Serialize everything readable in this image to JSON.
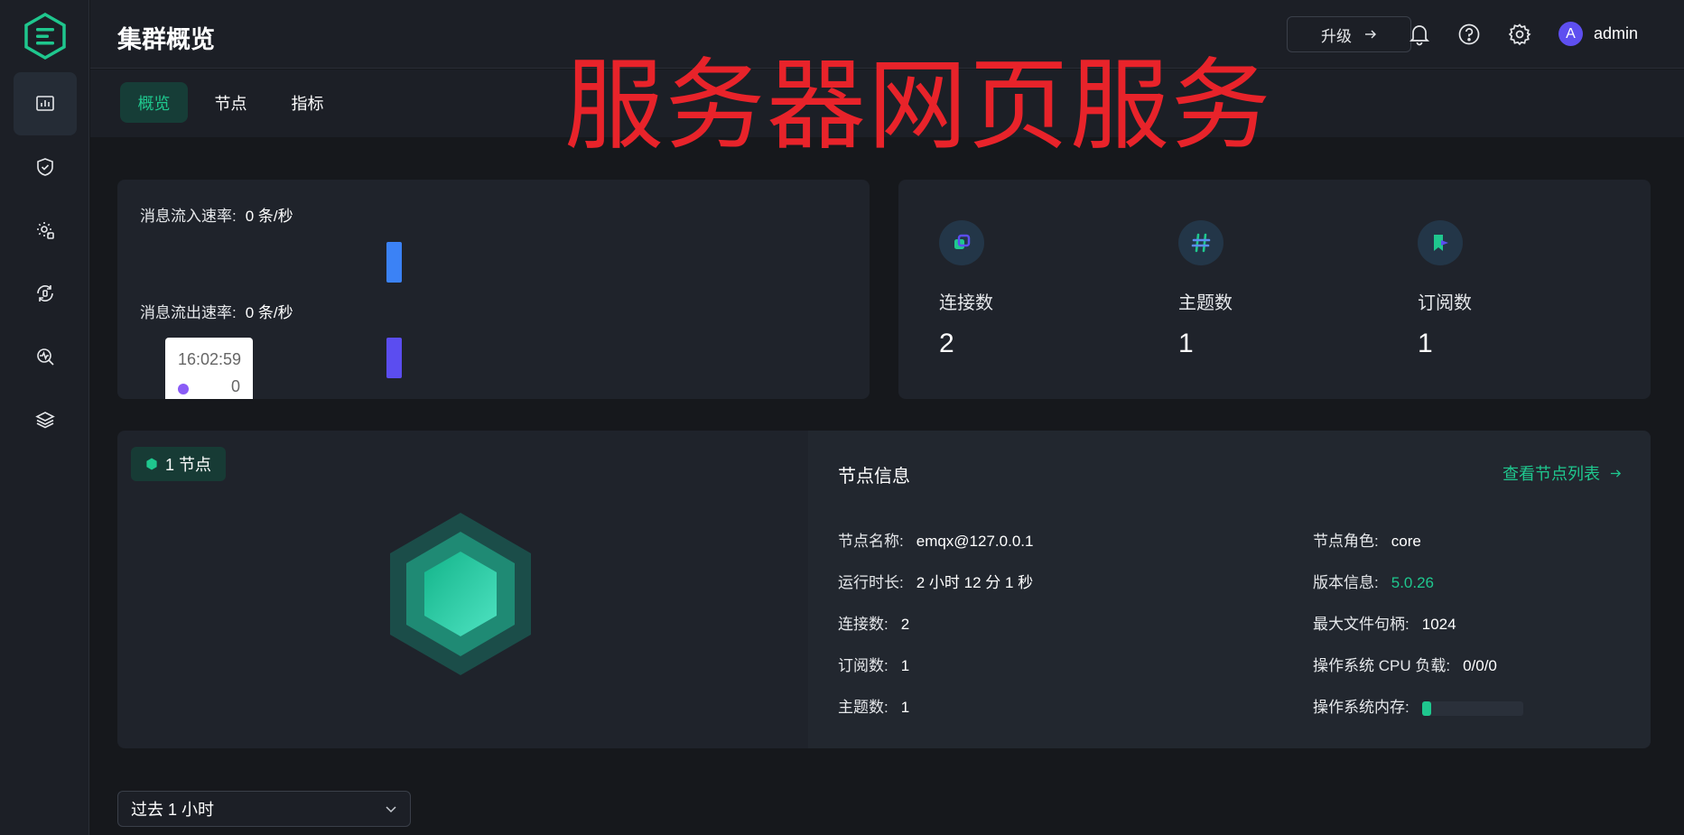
{
  "header": {
    "title": "集群概览",
    "upgrade_label": "升级",
    "user_initial": "A",
    "username": "admin"
  },
  "tabs": [
    {
      "label": "概览",
      "active": true
    },
    {
      "label": "节点",
      "active": false
    },
    {
      "label": "指标",
      "active": false
    }
  ],
  "watermark": "服务器网页服务",
  "sidebar": {
    "icons": [
      "dashboard-icon",
      "shield-icon",
      "gear-puzzle-icon",
      "sync-icon",
      "monitor-search-icon",
      "layers-icon"
    ]
  },
  "rates": {
    "in_label": "消息流入速率:",
    "in_value": "0 条/秒",
    "out_label": "消息流出速率:",
    "out_value": "0 条/秒",
    "tooltip_time": "16:02:59",
    "tooltip_value": "0"
  },
  "stats": [
    {
      "label": "连接数",
      "value": "2",
      "icon": "connection-icon"
    },
    {
      "label": "主题数",
      "value": "1",
      "icon": "hash-icon"
    },
    {
      "label": "订阅数",
      "value": "1",
      "icon": "subscribe-icon"
    }
  ],
  "nodes": {
    "badge": "1 节点"
  },
  "node_info": {
    "title": "节点信息",
    "link": "查看节点列表",
    "left": [
      {
        "label": "节点名称:",
        "value": "emqx@127.0.0.1"
      },
      {
        "label": "运行时长:",
        "value": "2 小时 12 分 1 秒"
      },
      {
        "label": "连接数:",
        "value": "2"
      },
      {
        "label": "订阅数:",
        "value": "1"
      },
      {
        "label": "主题数:",
        "value": "1"
      }
    ],
    "right": [
      {
        "label": "节点角色:",
        "value": "core"
      },
      {
        "label": "版本信息:",
        "value": "5.0.26"
      },
      {
        "label": "最大文件句柄:",
        "value": "1024"
      },
      {
        "label": "操作系统 CPU 负载:",
        "value": "0/0/0"
      },
      {
        "label": "操作系统内存:",
        "value": ""
      }
    ],
    "memory_usage_fraction": 0.09
  },
  "time_range": {
    "selected": "过去 1 小时"
  },
  "colors": {
    "accent": "#1fc78e",
    "in_bar": "#3b82f6",
    "out_bar": "#5b4df0"
  }
}
